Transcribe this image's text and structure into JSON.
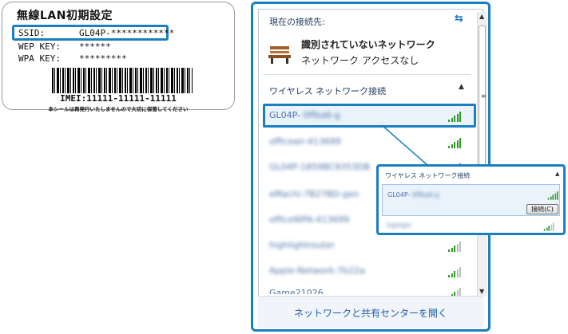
{
  "label": {
    "title": "無線LAN初期設定",
    "ssid_key": "SSID:",
    "ssid_value": "GL04P-************",
    "wep_key": "WEP KEY:",
    "wep_value": "******",
    "wpa_key": "WPA KEY:",
    "wpa_value": "*********",
    "imei": "IMEI:11111-11111-11111",
    "notice": "本シールは再発行いたしませんので大切に保管してください"
  },
  "flyout": {
    "current_header": "現在の接続先:",
    "current_network": "識別されていないネットワーク",
    "current_status": "ネットワーク アクセスなし",
    "wireless_header": "ワイヤレス ネットワーク接続",
    "networks": [
      {
        "name": "GL04P-",
        "blurred": "0ffba6-g",
        "bars": 5
      },
      {
        "name": "",
        "blurred": "officeair-413699",
        "bars": 5
      },
      {
        "name": "",
        "blurred": "GL04P-1859BC9353DB",
        "bars": 5
      },
      {
        "name": "",
        "blurred": "eMachi-7B27BD-gen",
        "bars": 5
      },
      {
        "name": "",
        "blurred": "officeWPA-413699",
        "bars": 4
      },
      {
        "name": "",
        "blurred": "highlightrouter",
        "bars": 3
      },
      {
        "name": "",
        "blurred": "Apple-Network-7b22a",
        "bars": 3
      },
      {
        "name": "Game21026",
        "blurred": "",
        "bars": 3
      }
    ],
    "footer_link": "ネットワークと共有センターを開く",
    "icons": {
      "refresh": "refresh-icon",
      "bench": "bench-icon",
      "collapse": "chevron-up-icon"
    }
  },
  "zoom": {
    "header": "ワイヤレス ネットワーク接続",
    "network_name": "GL04P-",
    "network_blur": "0ffba6-g",
    "connect_button": "接続(C)",
    "next_network_blur": "highlight"
  },
  "colors": {
    "accent": "#1a7fc1",
    "link": "#1d5fb0",
    "signal": "#2f9a23",
    "header_text": "#1e395b"
  }
}
